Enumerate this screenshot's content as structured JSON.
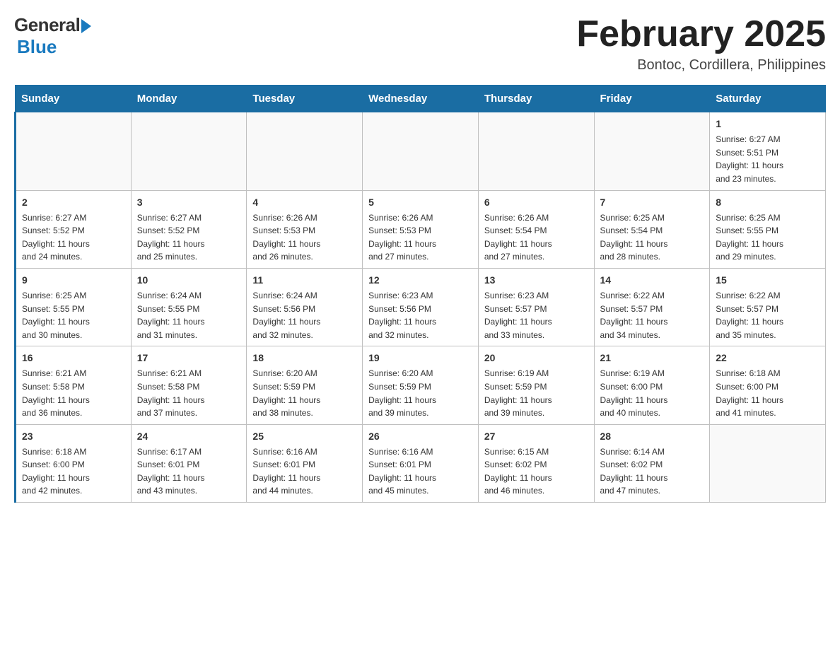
{
  "header": {
    "logo_general": "General",
    "logo_blue": "Blue",
    "title": "February 2025",
    "subtitle": "Bontoc, Cordillera, Philippines"
  },
  "days_of_week": [
    "Sunday",
    "Monday",
    "Tuesday",
    "Wednesday",
    "Thursday",
    "Friday",
    "Saturday"
  ],
  "weeks": [
    {
      "days": [
        {
          "number": "",
          "info": "",
          "empty": true
        },
        {
          "number": "",
          "info": "",
          "empty": true
        },
        {
          "number": "",
          "info": "",
          "empty": true
        },
        {
          "number": "",
          "info": "",
          "empty": true
        },
        {
          "number": "",
          "info": "",
          "empty": true
        },
        {
          "number": "",
          "info": "",
          "empty": true
        },
        {
          "number": "1",
          "info": "Sunrise: 6:27 AM\nSunset: 5:51 PM\nDaylight: 11 hours\nand 23 minutes.",
          "empty": false
        }
      ]
    },
    {
      "days": [
        {
          "number": "2",
          "info": "Sunrise: 6:27 AM\nSunset: 5:52 PM\nDaylight: 11 hours\nand 24 minutes.",
          "empty": false
        },
        {
          "number": "3",
          "info": "Sunrise: 6:27 AM\nSunset: 5:52 PM\nDaylight: 11 hours\nand 25 minutes.",
          "empty": false
        },
        {
          "number": "4",
          "info": "Sunrise: 6:26 AM\nSunset: 5:53 PM\nDaylight: 11 hours\nand 26 minutes.",
          "empty": false
        },
        {
          "number": "5",
          "info": "Sunrise: 6:26 AM\nSunset: 5:53 PM\nDaylight: 11 hours\nand 27 minutes.",
          "empty": false
        },
        {
          "number": "6",
          "info": "Sunrise: 6:26 AM\nSunset: 5:54 PM\nDaylight: 11 hours\nand 27 minutes.",
          "empty": false
        },
        {
          "number": "7",
          "info": "Sunrise: 6:25 AM\nSunset: 5:54 PM\nDaylight: 11 hours\nand 28 minutes.",
          "empty": false
        },
        {
          "number": "8",
          "info": "Sunrise: 6:25 AM\nSunset: 5:55 PM\nDaylight: 11 hours\nand 29 minutes.",
          "empty": false
        }
      ]
    },
    {
      "days": [
        {
          "number": "9",
          "info": "Sunrise: 6:25 AM\nSunset: 5:55 PM\nDaylight: 11 hours\nand 30 minutes.",
          "empty": false
        },
        {
          "number": "10",
          "info": "Sunrise: 6:24 AM\nSunset: 5:55 PM\nDaylight: 11 hours\nand 31 minutes.",
          "empty": false
        },
        {
          "number": "11",
          "info": "Sunrise: 6:24 AM\nSunset: 5:56 PM\nDaylight: 11 hours\nand 32 minutes.",
          "empty": false
        },
        {
          "number": "12",
          "info": "Sunrise: 6:23 AM\nSunset: 5:56 PM\nDaylight: 11 hours\nand 32 minutes.",
          "empty": false
        },
        {
          "number": "13",
          "info": "Sunrise: 6:23 AM\nSunset: 5:57 PM\nDaylight: 11 hours\nand 33 minutes.",
          "empty": false
        },
        {
          "number": "14",
          "info": "Sunrise: 6:22 AM\nSunset: 5:57 PM\nDaylight: 11 hours\nand 34 minutes.",
          "empty": false
        },
        {
          "number": "15",
          "info": "Sunrise: 6:22 AM\nSunset: 5:57 PM\nDaylight: 11 hours\nand 35 minutes.",
          "empty": false
        }
      ]
    },
    {
      "days": [
        {
          "number": "16",
          "info": "Sunrise: 6:21 AM\nSunset: 5:58 PM\nDaylight: 11 hours\nand 36 minutes.",
          "empty": false
        },
        {
          "number": "17",
          "info": "Sunrise: 6:21 AM\nSunset: 5:58 PM\nDaylight: 11 hours\nand 37 minutes.",
          "empty": false
        },
        {
          "number": "18",
          "info": "Sunrise: 6:20 AM\nSunset: 5:59 PM\nDaylight: 11 hours\nand 38 minutes.",
          "empty": false
        },
        {
          "number": "19",
          "info": "Sunrise: 6:20 AM\nSunset: 5:59 PM\nDaylight: 11 hours\nand 39 minutes.",
          "empty": false
        },
        {
          "number": "20",
          "info": "Sunrise: 6:19 AM\nSunset: 5:59 PM\nDaylight: 11 hours\nand 39 minutes.",
          "empty": false
        },
        {
          "number": "21",
          "info": "Sunrise: 6:19 AM\nSunset: 6:00 PM\nDaylight: 11 hours\nand 40 minutes.",
          "empty": false
        },
        {
          "number": "22",
          "info": "Sunrise: 6:18 AM\nSunset: 6:00 PM\nDaylight: 11 hours\nand 41 minutes.",
          "empty": false
        }
      ]
    },
    {
      "days": [
        {
          "number": "23",
          "info": "Sunrise: 6:18 AM\nSunset: 6:00 PM\nDaylight: 11 hours\nand 42 minutes.",
          "empty": false
        },
        {
          "number": "24",
          "info": "Sunrise: 6:17 AM\nSunset: 6:01 PM\nDaylight: 11 hours\nand 43 minutes.",
          "empty": false
        },
        {
          "number": "25",
          "info": "Sunrise: 6:16 AM\nSunset: 6:01 PM\nDaylight: 11 hours\nand 44 minutes.",
          "empty": false
        },
        {
          "number": "26",
          "info": "Sunrise: 6:16 AM\nSunset: 6:01 PM\nDaylight: 11 hours\nand 45 minutes.",
          "empty": false
        },
        {
          "number": "27",
          "info": "Sunrise: 6:15 AM\nSunset: 6:02 PM\nDaylight: 11 hours\nand 46 minutes.",
          "empty": false
        },
        {
          "number": "28",
          "info": "Sunrise: 6:14 AM\nSunset: 6:02 PM\nDaylight: 11 hours\nand 47 minutes.",
          "empty": false
        },
        {
          "number": "",
          "info": "",
          "empty": true
        }
      ]
    }
  ]
}
